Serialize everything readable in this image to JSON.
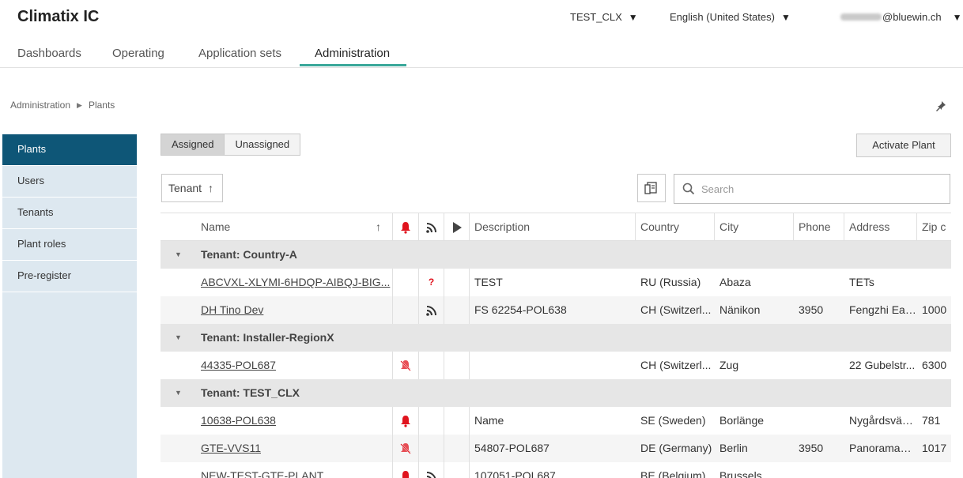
{
  "app": {
    "title": "Climatix IC"
  },
  "topbar": {
    "tenant": "TEST_CLX",
    "language": "English (United States)",
    "user_domain": "@bluewin.ch"
  },
  "nav": {
    "tabs": [
      "Dashboards",
      "Operating",
      "Application sets",
      "Administration"
    ],
    "active": "Administration"
  },
  "breadcrumb": {
    "root": "Administration",
    "current": "Plants"
  },
  "sidebar": {
    "items": [
      "Plants",
      "Users",
      "Tenants",
      "Plant roles",
      "Pre-register"
    ],
    "active": "Plants"
  },
  "toolbar": {
    "assigned": "Assigned",
    "unassigned": "Unassigned",
    "activate": "Activate Plant",
    "sort_label": "Tenant",
    "search_placeholder": "Search"
  },
  "grid": {
    "columns": {
      "name": "Name",
      "description": "Description",
      "country": "Country",
      "city": "City",
      "phone": "Phone",
      "address": "Address",
      "zip": "Zip c"
    },
    "groups": [
      {
        "label": "Tenant: Country-A"
      },
      {
        "label": "Tenant: Installer-RegionX"
      },
      {
        "label": "Tenant: TEST_CLX"
      }
    ],
    "rows": [
      {
        "name": "ABCVXL-XLYMI-6HDQP-AIBQJ-BIG...",
        "alarm": "",
        "conn": "unknown",
        "desc": "TEST",
        "country": "RU (Russia)",
        "city": "Abaza",
        "phone": "",
        "address": "TETs",
        "zip": ""
      },
      {
        "name": "DH Tino Dev",
        "alarm": "",
        "conn": "online",
        "desc": "FS 62254-POL638",
        "country": "CH (Switzerl...",
        "city": "Nänikon",
        "phone": "3950",
        "address": "Fengzhi Eas...",
        "zip": "1000"
      },
      {
        "name": "44335-POL687",
        "alarm": "muted",
        "conn": "",
        "desc": "",
        "country": "CH (Switzerl...",
        "city": "Zug",
        "phone": "",
        "address": "22 Gubelstr...",
        "zip": "6300"
      },
      {
        "name": "10638-POL638",
        "alarm": "active",
        "conn": "",
        "desc": "Name",
        "country": "SE (Sweden)",
        "city": "Borlänge",
        "phone": "",
        "address": "Nygårdsväg...",
        "zip": "781"
      },
      {
        "name": "GTE-VVS11",
        "alarm": "muted",
        "conn": "",
        "desc": "54807-POL687",
        "country": "DE (Germany)",
        "city": "Berlin",
        "phone": "3950",
        "address": "Panoramast...",
        "zip": "1017"
      },
      {
        "name": "NEW-TEST-GTE-PLANT",
        "alarm": "active",
        "conn": "online",
        "desc": "107051-POL687",
        "country": "BE (Belgium)",
        "city": "Brussels",
        "phone": "",
        "address": "",
        "zip": ""
      }
    ]
  },
  "colors": {
    "accent": "#3aa79a",
    "sidebar_active": "#0e5677",
    "sidebar_bg": "#dde8f0",
    "alarm": "#e0141e"
  },
  "icons": [
    "pin-icon",
    "bell-icon",
    "wifi-icon",
    "play-icon",
    "column-chooser-icon",
    "search-icon",
    "sort-up-icon"
  ]
}
